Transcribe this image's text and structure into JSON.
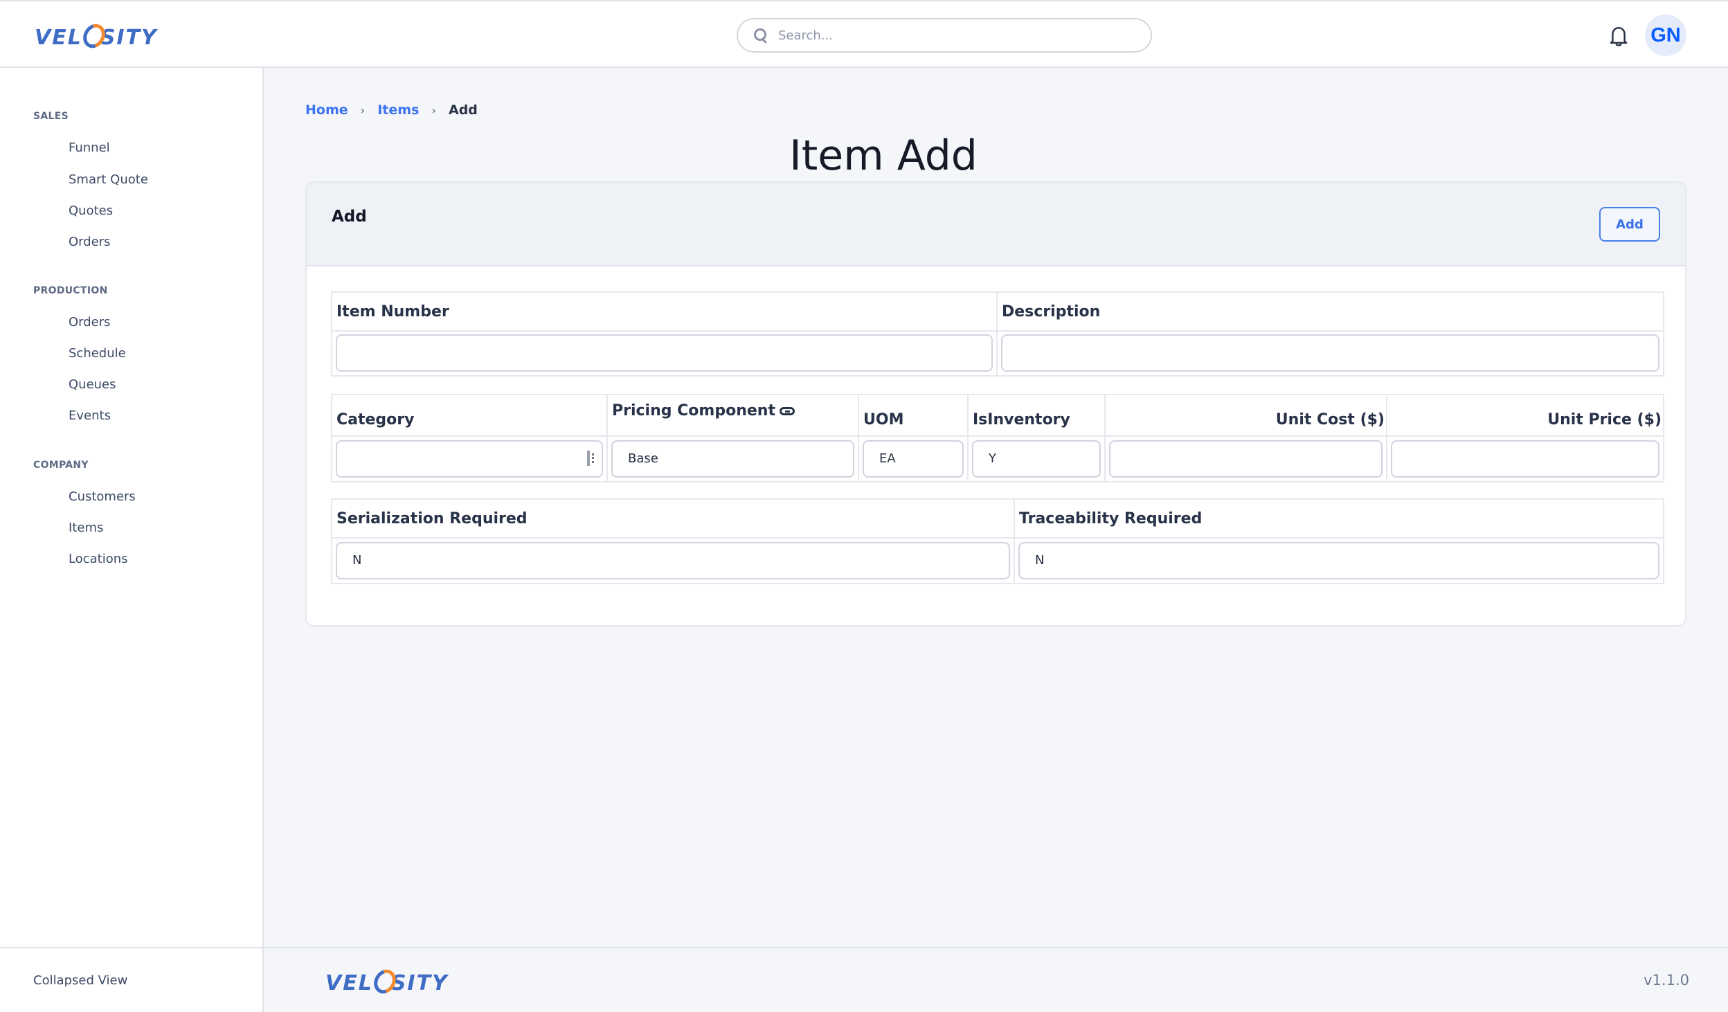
{
  "header": {
    "logo_text_left": "VEL",
    "logo_text_right": "SITY",
    "search_placeholder": "Search...",
    "avatar_initials": "GN",
    "icons": {
      "search": "search-icon",
      "notifications": "bell-icon"
    }
  },
  "sidebar": {
    "sections": [
      {
        "title": "SALES",
        "items": [
          "Funnel",
          "Smart Quote",
          "Quotes",
          "Orders"
        ]
      },
      {
        "title": "PRODUCTION",
        "items": [
          "Orders",
          "Schedule",
          "Queues",
          "Events"
        ]
      },
      {
        "title": "COMPANY",
        "items": [
          "Customers",
          "Items",
          "Locations"
        ]
      }
    ],
    "collapsed_view_label": "Collapsed View"
  },
  "breadcrumb": {
    "home": "Home",
    "items": "Items",
    "current": "Add"
  },
  "page_title": "Item Add",
  "card": {
    "title": "Add",
    "add_button": "Add",
    "fields": {
      "item_number": {
        "label": "Item Number",
        "value": ""
      },
      "description": {
        "label": "Description",
        "value": ""
      },
      "category": {
        "label": "Category",
        "value": ""
      },
      "pricing_component": {
        "label": "Pricing Component",
        "value": "Base"
      },
      "uom": {
        "label": "UOM",
        "value": "EA"
      },
      "is_inventory": {
        "label": "IsInventory",
        "value": "Y"
      },
      "unit_cost": {
        "label": "Unit Cost ($)",
        "value": ""
      },
      "unit_price": {
        "label": "Unit Price ($)",
        "value": ""
      },
      "serialization_required": {
        "label": "Serialization Required",
        "value": "N"
      },
      "traceability_required": {
        "label": "Traceability Required",
        "value": "N"
      }
    }
  },
  "footer": {
    "version": "v1.1.0"
  },
  "colors": {
    "brand_blue": "#3f6cc4",
    "brand_orange": "#f28a30",
    "link": "#3b73f0",
    "avatar_text": "#0b5cff"
  }
}
